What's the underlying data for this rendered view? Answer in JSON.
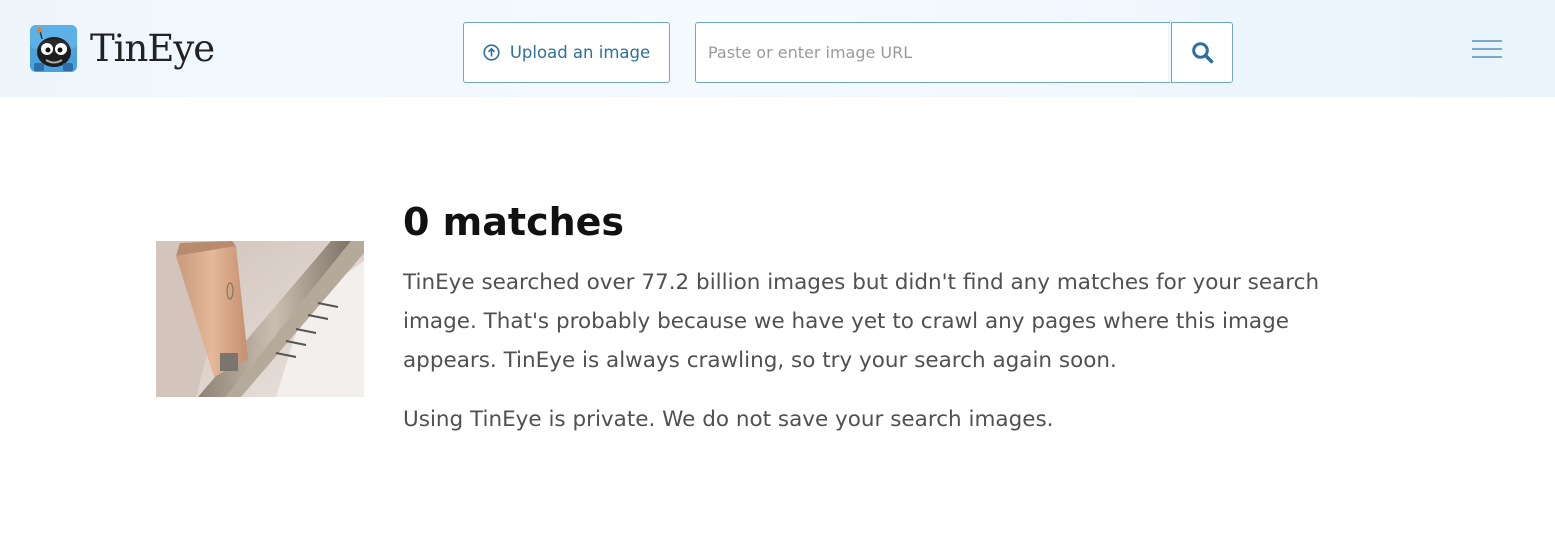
{
  "header": {
    "logo_text": "TinEye",
    "upload_label": "Upload an image",
    "url_placeholder": "Paste or enter image URL",
    "url_value": "",
    "search_icon": "search-icon",
    "menu_icon": "hamburger-menu-icon"
  },
  "result": {
    "title": "0 matches",
    "description": "TinEye searched over 77.2 billion images but didn't find any matches for your search image. That's probably because we have yet to crawl any pages where this image appears. TinEye is always crawling, so try your search again soon.",
    "privacy_note": "Using TinEye is private. We do not save your search images."
  },
  "colors": {
    "accent": "#2f6f9c",
    "border": "#6ea8c9",
    "header_bg": "#eef6fc",
    "menu": "#7aaad0"
  }
}
